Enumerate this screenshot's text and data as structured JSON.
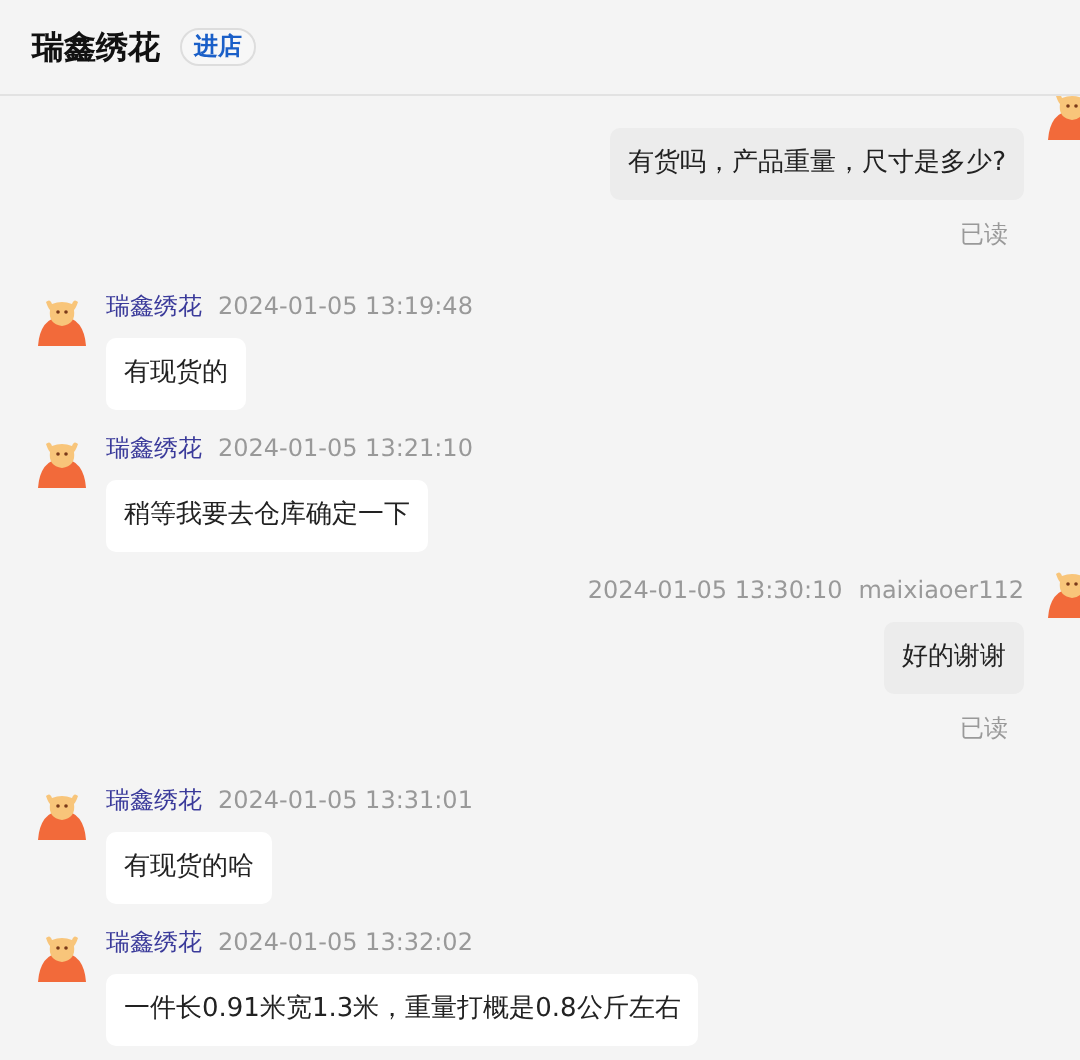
{
  "header": {
    "title": "瑞鑫绣花",
    "shop_button": "进店"
  },
  "messages": [
    {
      "kind": "out",
      "text": "有货吗，产品重量，尺寸是多少?",
      "status": "已读"
    },
    {
      "kind": "in",
      "sender": "瑞鑫绣花",
      "time": "2024-01-05 13:19:48",
      "text": "有现货的"
    },
    {
      "kind": "in",
      "sender": "瑞鑫绣花",
      "time": "2024-01-05 13:21:10",
      "text": "稍等我要去仓库确定一下"
    },
    {
      "kind": "out",
      "time": "2024-01-05 13:30:10",
      "sender": "maixiaoer112",
      "text": "好的谢谢",
      "status": "已读"
    },
    {
      "kind": "in",
      "sender": "瑞鑫绣花",
      "time": "2024-01-05 13:31:01",
      "text": "有现货的哈"
    },
    {
      "kind": "in",
      "sender": "瑞鑫绣花",
      "time": "2024-01-05 13:32:02",
      "text": "一件长0.91米宽1.3米，重量打概是0.8公斤左右"
    }
  ]
}
